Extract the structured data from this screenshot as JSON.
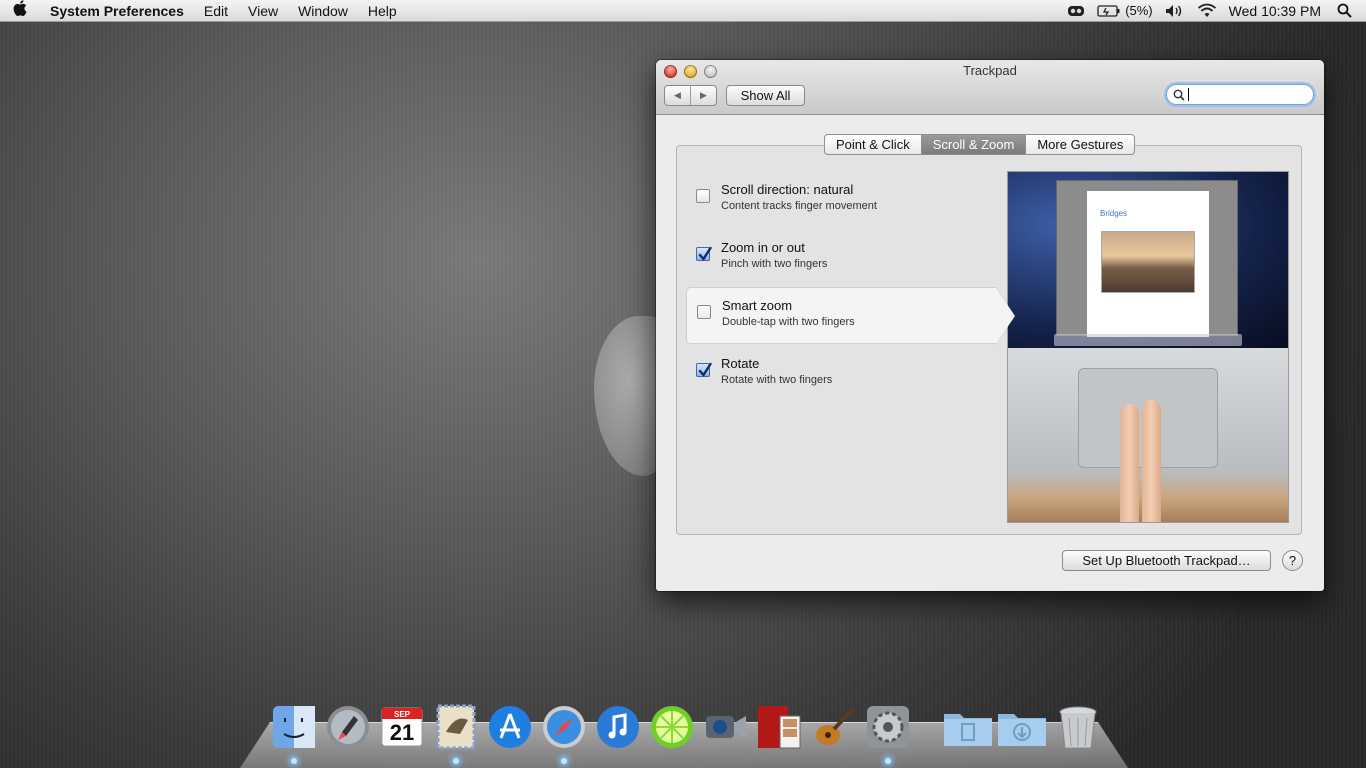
{
  "menubar": {
    "app_name": "System Preferences",
    "menus": [
      "Edit",
      "View",
      "Window",
      "Help"
    ],
    "battery_text": "(5%)",
    "clock": "Wed 10:39 PM"
  },
  "window": {
    "title": "Trackpad",
    "show_all_label": "Show All",
    "search_placeholder": "",
    "tabs": [
      "Point & Click",
      "Scroll & Zoom",
      "More Gestures"
    ],
    "selected_tab": "Scroll & Zoom",
    "options": [
      {
        "title": "Scroll direction: natural",
        "subtitle": "Content tracks finger movement",
        "checked": false
      },
      {
        "title": "Zoom in or out",
        "subtitle": "Pinch with two fingers",
        "checked": true
      },
      {
        "title": "Smart zoom",
        "subtitle": "Double-tap with two fingers",
        "checked": false
      },
      {
        "title": "Rotate",
        "subtitle": "Rotate with two fingers",
        "checked": true
      }
    ],
    "preview": {
      "doc_heading": "Bridges"
    },
    "setup_button": "Set Up Bluetooth Trackpad…",
    "help_label": "?"
  },
  "dock": {
    "items": [
      "finder",
      "launchpad",
      "calendar",
      "mail",
      "app-store",
      "safari",
      "itunes",
      "limewire",
      "facetime",
      "photo-booth",
      "garageband",
      "system-preferences",
      "documents-folder",
      "downloads-folder",
      "trash"
    ],
    "calendar_month": "SEP",
    "calendar_day": "21"
  }
}
